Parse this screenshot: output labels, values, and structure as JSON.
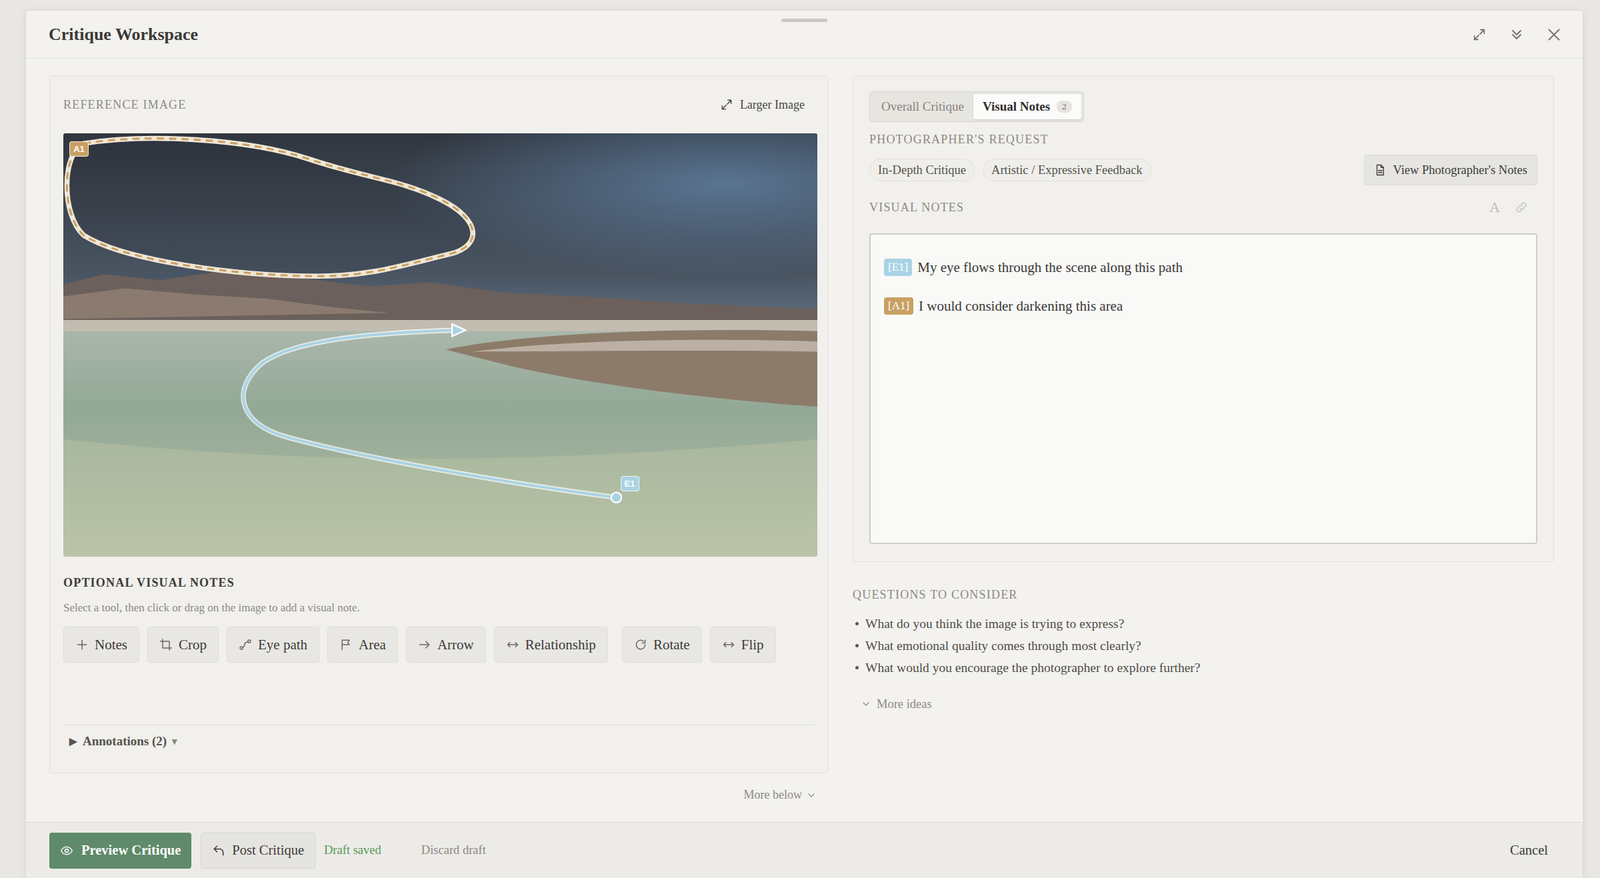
{
  "window": {
    "title": "Critique Workspace"
  },
  "reference": {
    "label": "REFERENCE IMAGE",
    "larger": "Larger Image",
    "annotations": [
      {
        "id": "A1",
        "kind": "area",
        "color": "#c9a063"
      },
      {
        "id": "E1",
        "kind": "eyepath",
        "color": "#a9d3e4"
      }
    ]
  },
  "tools": {
    "title": "OPTIONAL VISUAL NOTES",
    "hint": "Select a tool, then click or drag on the image to add a visual note.",
    "edit": [
      {
        "label": "Notes"
      },
      {
        "label": "Crop"
      },
      {
        "label": "Eye path"
      },
      {
        "label": "Area"
      },
      {
        "label": "Arrow"
      },
      {
        "label": "Relationship"
      }
    ],
    "transform": [
      {
        "label": "Rotate"
      },
      {
        "label": "Flip"
      }
    ]
  },
  "annotations_toggle": {
    "arrow": "▶",
    "label": "Annotations (2)",
    "caret": "▾",
    "expanded": false
  },
  "more_below": "More below",
  "tabs": [
    {
      "label": "Overall Critique",
      "selected": false
    },
    {
      "label": "Visual Notes",
      "count": "2",
      "selected": true
    }
  ],
  "request": {
    "label": "PHOTOGRAPHER'S REQUEST",
    "chips": [
      "In-Depth Critique",
      "Artistic / Expressive Feedback"
    ],
    "button": "View Photographer's Notes"
  },
  "notes": {
    "label": "VISUAL NOTES",
    "format_icon": "A",
    "items": [
      {
        "tag": "[E1]",
        "text": "My eye flows through the scene along this path",
        "color": "#a9d3e4"
      },
      {
        "tag": "[A1]",
        "text": "I would consider darkening this area",
        "color": "#c9a063"
      }
    ]
  },
  "questions": {
    "title": "QUESTIONS TO CONSIDER",
    "items": [
      "What do you think the image is trying to express?",
      "What emotional quality comes through most clearly?",
      "What would you encourage the photographer to explore further?"
    ],
    "more": "More ideas"
  },
  "footer": {
    "preview": "Preview Critique",
    "post": "Post Critique",
    "status": "Draft saved",
    "discard": "Discard draft",
    "cancel": "Cancel"
  }
}
